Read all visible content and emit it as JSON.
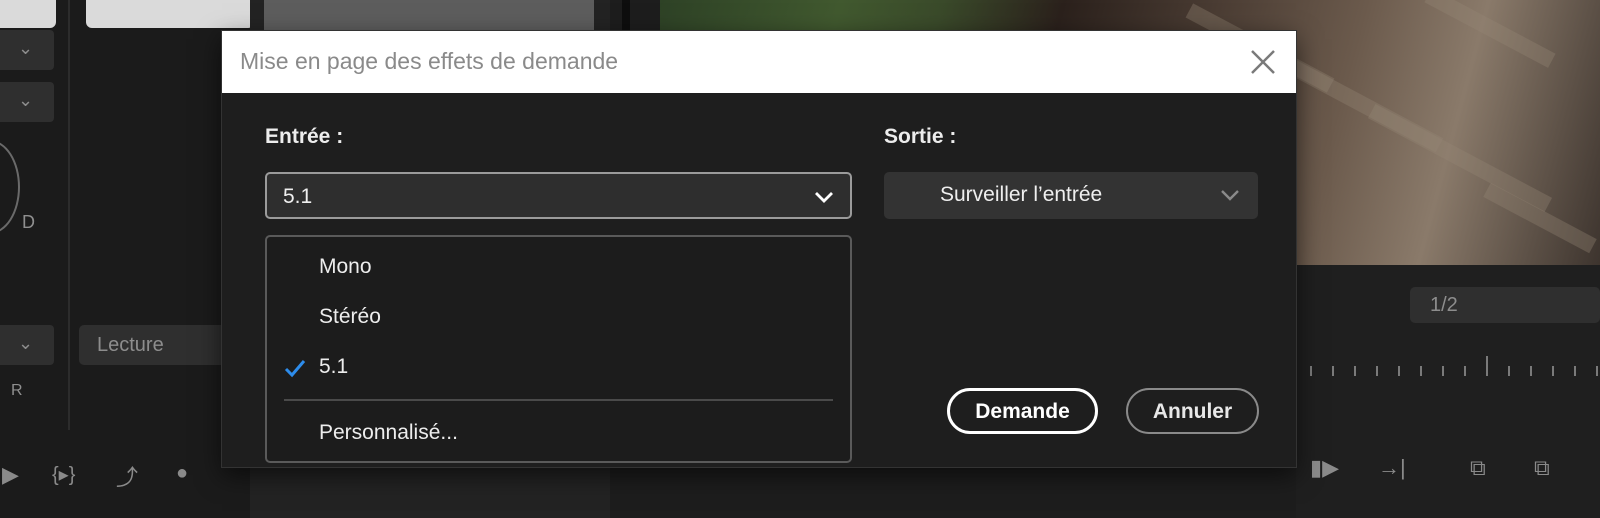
{
  "background": {
    "left_letters": [
      "D",
      "R"
    ],
    "lecture_dropdown": "Lecture",
    "pager": "1/2"
  },
  "dialog": {
    "title": "Mise en page des effets de demande",
    "input": {
      "label": "Entrée :",
      "selected": "5.1",
      "options": [
        "Mono",
        "Stéréo",
        "5.1"
      ],
      "custom_option": "Personnalisé..."
    },
    "output": {
      "label": "Sortie :",
      "selected": "Surveiller l’entrée"
    },
    "buttons": {
      "ok": "Demande",
      "cancel": "Annuler"
    },
    "accent_color": "#2d8ceb"
  }
}
